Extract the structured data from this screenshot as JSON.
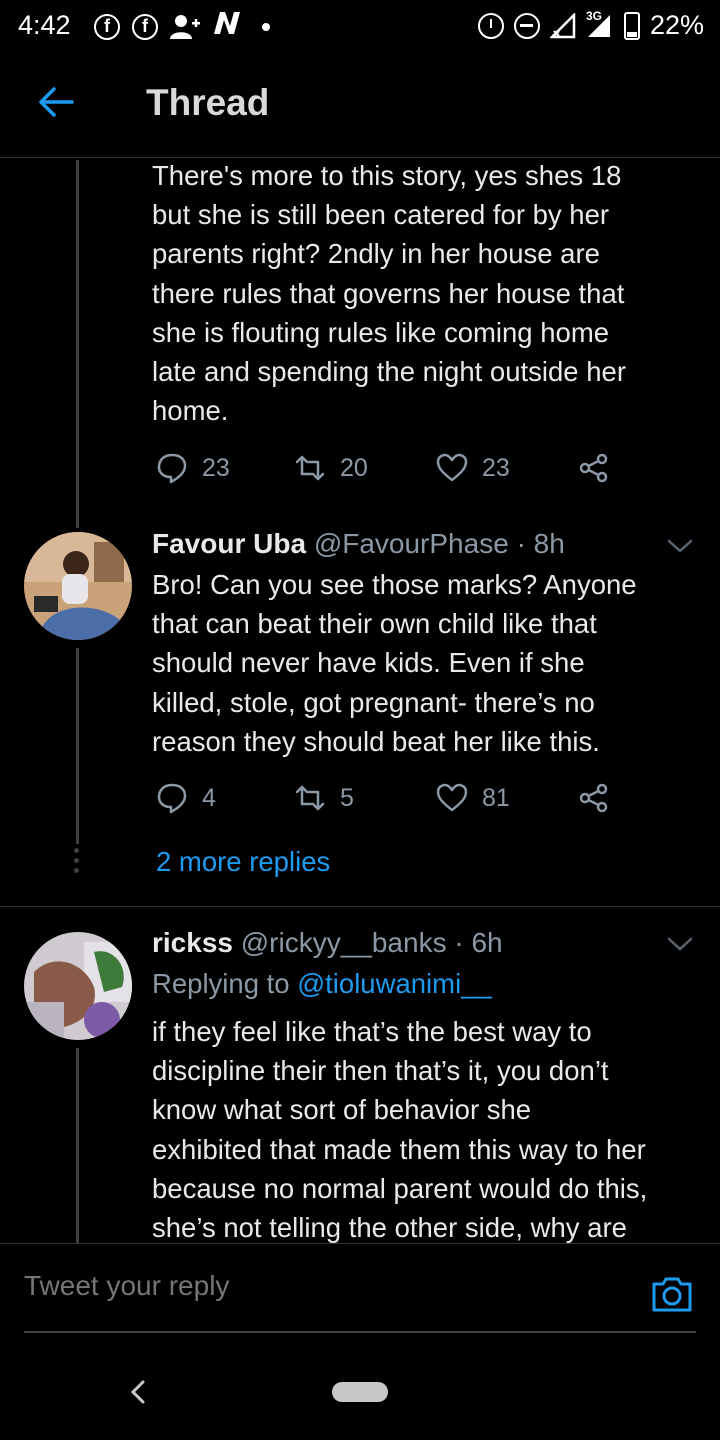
{
  "status_bar": {
    "time": "4:42",
    "network_label": "3G",
    "battery": "22%",
    "left_icons": [
      "facebook-icon",
      "facebook-icon",
      "add-person-icon",
      "n-icon"
    ],
    "right_icons": [
      "alarm-icon",
      "do-not-disturb-icon",
      "signal-icon",
      "battery-icon"
    ]
  },
  "header": {
    "title": "Thread"
  },
  "tweets": [
    {
      "text_lines": [
        "There's more to this story, yes shes 18",
        "but she is still been catered for by her",
        "parents right?  2ndly in her house are",
        "there rules that governs her house that",
        "she is flouting rules like coming home",
        "late and spending the night outside her",
        "home."
      ],
      "replies": "23",
      "retweets": "20",
      "likes": "23"
    },
    {
      "name": "Favour Uba",
      "handle": "@FavourPhase",
      "time": "8h",
      "text_lines": [
        "Bro! Can you see those marks? Anyone",
        "that can beat their own child like that",
        "should never have kids. Even if she",
        "killed, stole, got pregnant- there’s no",
        "reason they should beat her like this."
      ],
      "replies": "4",
      "retweets": "5",
      "likes": "81",
      "more_replies": "2 more replies"
    },
    {
      "name": "rickss",
      "handle": "@rickyy__banks",
      "time": "6h",
      "replying_prefix": "Replying to ",
      "replying_to": "@tioluwanimi__",
      "text_lines": [
        "if they feel like that’s the best way to",
        "discipline their then that’s it, you don’t",
        "know what sort of behavior she",
        "exhibited that made them this way to her",
        "because no normal parent would do this,",
        "she’s not telling the other side, why are"
      ]
    }
  ],
  "reply_bar": {
    "placeholder": "Tweet your reply"
  },
  "colors": {
    "background": "#000000",
    "accent": "#1d9bf0",
    "muted": "#8b98a5",
    "text": "#e7e9ea"
  }
}
